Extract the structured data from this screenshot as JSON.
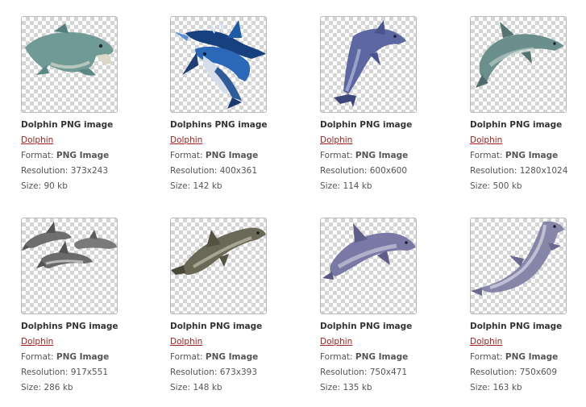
{
  "items": [
    {
      "title": "Dolphin PNG image",
      "category": "Dolphin",
      "format_label": "Format:",
      "format": "PNG Image",
      "resolution_label": "Resolution:",
      "resolution": "373x243",
      "size_label": "Size:",
      "size": "90 kb"
    },
    {
      "title": "Dolphins PNG image",
      "category": "Dolphin",
      "format_label": "Format:",
      "format": "PNG Image",
      "resolution_label": "Resolution:",
      "resolution": "400x361",
      "size_label": "Size:",
      "size": "142 kb"
    },
    {
      "title": "Dolphin PNG image",
      "category": "Dolphin",
      "format_label": "Format:",
      "format": "PNG Image",
      "resolution_label": "Resolution:",
      "resolution": "600x600",
      "size_label": "Size:",
      "size": "114 kb"
    },
    {
      "title": "Dolphin PNG image",
      "category": "Dolphin",
      "format_label": "Format:",
      "format": "PNG Image",
      "resolution_label": "Resolution:",
      "resolution": "1280x1024",
      "size_label": "Size:",
      "size": "500 kb"
    },
    {
      "title": "Dolphins PNG image",
      "category": "Dolphin",
      "format_label": "Format:",
      "format": "PNG Image",
      "resolution_label": "Resolution:",
      "resolution": "917x551",
      "size_label": "Size:",
      "size": "286 kb"
    },
    {
      "title": "Dolphin PNG image",
      "category": "Dolphin",
      "format_label": "Format:",
      "format": "PNG Image",
      "resolution_label": "Resolution:",
      "resolution": "673x393",
      "size_label": "Size:",
      "size": "148 kb"
    },
    {
      "title": "Dolphin PNG image",
      "category": "Dolphin",
      "format_label": "Format:",
      "format": "PNG Image",
      "resolution_label": "Resolution:",
      "resolution": "750x471",
      "size_label": "Size:",
      "size": "135 kb"
    },
    {
      "title": "Dolphin PNG image",
      "category": "Dolphin",
      "format_label": "Format:",
      "format": "PNG Image",
      "resolution_label": "Resolution:",
      "resolution": "750x609",
      "size_label": "Size:",
      "size": "163 kb"
    }
  ],
  "colors": {
    "link": "#a52020",
    "title": "#333333",
    "meta": "#555555",
    "thumb_border": "#b9b9b9",
    "checker": "#d4d4d4"
  }
}
